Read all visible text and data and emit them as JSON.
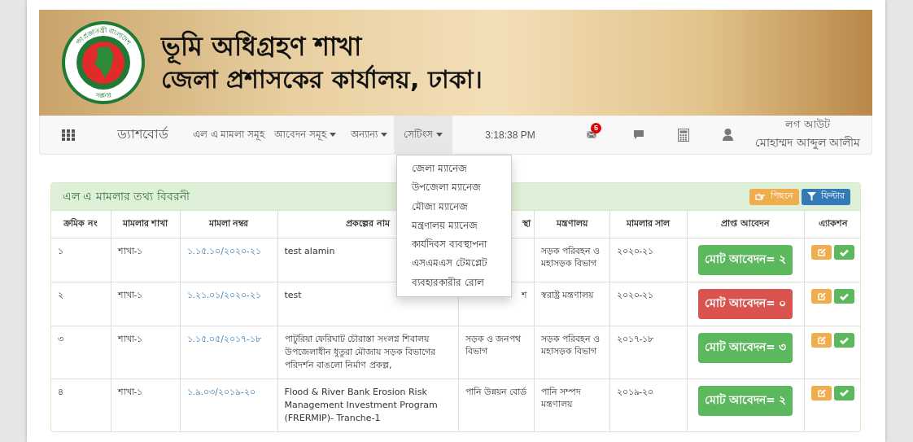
{
  "header": {
    "logo_top": "গণপ্রজাতন্ত্রী বাংলাদেশ",
    "logo_bottom": "সরকার",
    "title": "ভূমি অধিগ্রহণ শাখা",
    "subtitle": "জেলা প্রশাসকের কার্যালয়, ঢাকা।"
  },
  "nav": {
    "items": [
      {
        "kind": "grid",
        "selected": false
      },
      {
        "kind": "brand",
        "label": "ড্যাশবোর্ড",
        "selected": false
      },
      {
        "kind": "link",
        "label": "এল এ মামলা সমূহ",
        "selected": false
      },
      {
        "kind": "dropdown",
        "label": "আবেদন সমূহ",
        "selected": false
      },
      {
        "kind": "dropdown",
        "label": "অন্যান্য",
        "selected": false
      },
      {
        "kind": "dropdown",
        "label": "সেটিংস",
        "selected": true
      }
    ],
    "time": "3:18:38 PM",
    "mail_badge": "5",
    "logout": "লগ আউট",
    "user_name": "মোহাম্মদ আব্দুল আলীম"
  },
  "dropdown_menu": {
    "items": [
      "জেলা ম্যানেজ",
      "উপজেলা ম্যানেজ",
      "মৌজা ম্যানেজ",
      "মন্ত্রণালয় ম্যানেজ",
      "কার্যদিবস ব্যবস্থাপনা",
      "এসএমএস টেমপ্লেট",
      "ব্যবহারকারীর রোল"
    ]
  },
  "panel": {
    "title": "এল এ মামলার তথ্য বিবরনী",
    "buttons": [
      {
        "kind": "back",
        "label": "পিছনে"
      },
      {
        "kind": "filter",
        "label": "ফিল্টার"
      }
    ],
    "table": {
      "columns": [
        {
          "label": "ক্রমিক নং"
        },
        {
          "label": "মামলার শাখা"
        },
        {
          "label": "মামলা নম্বর"
        },
        {
          "label": "প্রকল্পের নাম"
        },
        {
          "label": "স্থা",
          "cut_off": true
        },
        {
          "label": "মন্ত্রণালয়"
        },
        {
          "label": "মামলার সাল"
        },
        {
          "label": "প্রাপ্ত আবেদন"
        },
        {
          "label": "এ্যাকশন"
        }
      ],
      "rows": [
        {
          "serial": "১",
          "branch": "শাখা-১",
          "case_no": "১.১৫.১০/২০২০-২১",
          "project": "test alamin",
          "ministry": "সড়ক পরিবহন ও মহাসড়ক বিভাগ",
          "year": "২০২০-২১",
          "total": {
            "label": "মোট আবেদন= ২",
            "color": "#5cb85c"
          }
        },
        {
          "serial": "২",
          "branch": "শাখা-১",
          "case_no": "১.২১.০১/২০২০-২১",
          "project": "test",
          "column_5": {
            "text": "শ",
            "cut_off": true
          },
          "ministry": "স্বরাষ্ট্র মন্ত্রণালয়",
          "year": "২০২০-২১",
          "total": {
            "label": "মোট আবেদন= ০",
            "color": "#d9534f"
          }
        },
        {
          "serial": "৩",
          "branch": "শাখা-১",
          "case_no": "১.১৫.০৫/২০১৭-১৮",
          "project": "পাটুরিয়া ফেরিঘাট চৌরাস্তা সংলগ্ন শিবালয় উপজেলাধীন ধুতুরা মৌজায় সড়ক বিভাগের পরিদর্শন বাঙলো নির্মাণ প্রকল্প,",
          "column_5": {
            "text": "সড়ক ও জনপথ বিভাগ"
          },
          "ministry": "সড়ক পরিবহন ও মহাসড়ক বিভাগ",
          "year": "২০১৭-১৮",
          "total": {
            "label": "মোট আবেদন= ৩",
            "color": "#5cb85c"
          }
        },
        {
          "serial": "৪",
          "branch": "শাখা-১",
          "case_no": "১.৯.০৩/২০১৯-২০",
          "project": "Flood & River Bank Erosion Risk Management Investment Program (FRERMIP)- Tranche-1",
          "column_5": {
            "text": "পানি উন্নয়ন বোর্ড"
          },
          "ministry": "পানি সম্পদ মন্ত্রণালয়",
          "year": "২০১৯-২০",
          "total": {
            "label": "মোট আবেদন= ২",
            "color": "#5cb85c"
          }
        }
      ]
    }
  }
}
